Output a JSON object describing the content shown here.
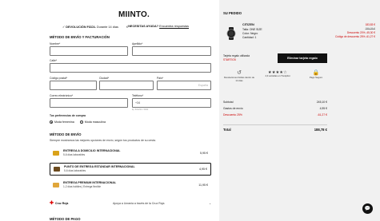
{
  "brand": {
    "logo": "MIINTO."
  },
  "perks": {
    "return_strong": "DEVOLUCIÓN FÁCIL",
    "return_rest": " Durante 14 días",
    "help_strong": "¿NECESITAS AYUDA?",
    "help_link": "Encuentra respuestas"
  },
  "shipping_form": {
    "title": "Método de envío y facturación",
    "fields": {
      "first_name_label": "Nombre*",
      "last_name_label": "Apellido*",
      "street_label": "Calle*",
      "postal_label": "Código postal*",
      "city_label": "Ciudad*",
      "country_label": "País*",
      "country_value": "España",
      "email_label": "Correo electrónico*",
      "phone_label": "Teléfono*",
      "phone_prefix": "+34",
      "phone_hint": "Ej: 601234 / 5004"
    },
    "purchase_pref_label": "Tus preferencias de compra",
    "pref_options": [
      "Moda femenina",
      "Moda masculina"
    ],
    "pref_selected": 0
  },
  "shipping_method": {
    "title": "Método de envío",
    "note": "Siempre mostramos las mejores opciones de envío, según tus productos de su cesta.",
    "options": [
      {
        "name": "ENTREGA A DOMICILIO INTERNACIONAL",
        "eta": "5-6 días laborables",
        "price": "5,95 €",
        "color": "#d9a21a"
      },
      {
        "name": "PUNTO DE ENTREGA ESTÁNDAR INTERNACIONAL",
        "eta": "5-6 días laborables",
        "price": "4,95 €",
        "color": "#6b4a1e"
      },
      {
        "name": "ENTREGA PREMIUM INTERNACIONAL",
        "eta": "1-2 días hábiles | Entrega flexible",
        "price": "11,95 €",
        "color": "#e0a63a"
      }
    ],
    "selected": 1
  },
  "red_cross": {
    "name": "Cruz Roja",
    "text": "Apoya a Ucrania a través de la Cruz Roja"
  },
  "next_section_title": "Método de pago",
  "summary": {
    "title": "Su pedido",
    "product": {
      "name": "CITIZEN",
      "size": "Talla: ONE SIZE",
      "color": "Color: Negro",
      "qty": "Cantidad: 1",
      "price": "183,83 €",
      "old_price": "299,28 €",
      "discount1": "Descuento 20% -45,30 €",
      "discount2": "Código de descuento 25% -61,27 €"
    },
    "coupon": {
      "label": "Tarjeta regalo utilizada",
      "code": "STARTIO5",
      "button": "Eliminar tarjeta regalo"
    },
    "badges": [
      {
        "icon": "↺",
        "text": "Devoluciones fáciles dentro de 14 días"
      },
      {
        "stars": "★★★★☆",
        "text": "4,3 estrellas en Trustpilot"
      },
      {
        "icon": "🔒",
        "text": "Pago Seguro"
      }
    ],
    "rows": [
      {
        "label": "Subtotal",
        "value": "245,10 €"
      },
      {
        "label": "Gastos de envío",
        "value": "4,95 €"
      },
      {
        "label": "Descuento 25%",
        "value": "-61,27 €",
        "red": true
      }
    ],
    "total_label": "Total",
    "total_value": "188,78 €"
  }
}
